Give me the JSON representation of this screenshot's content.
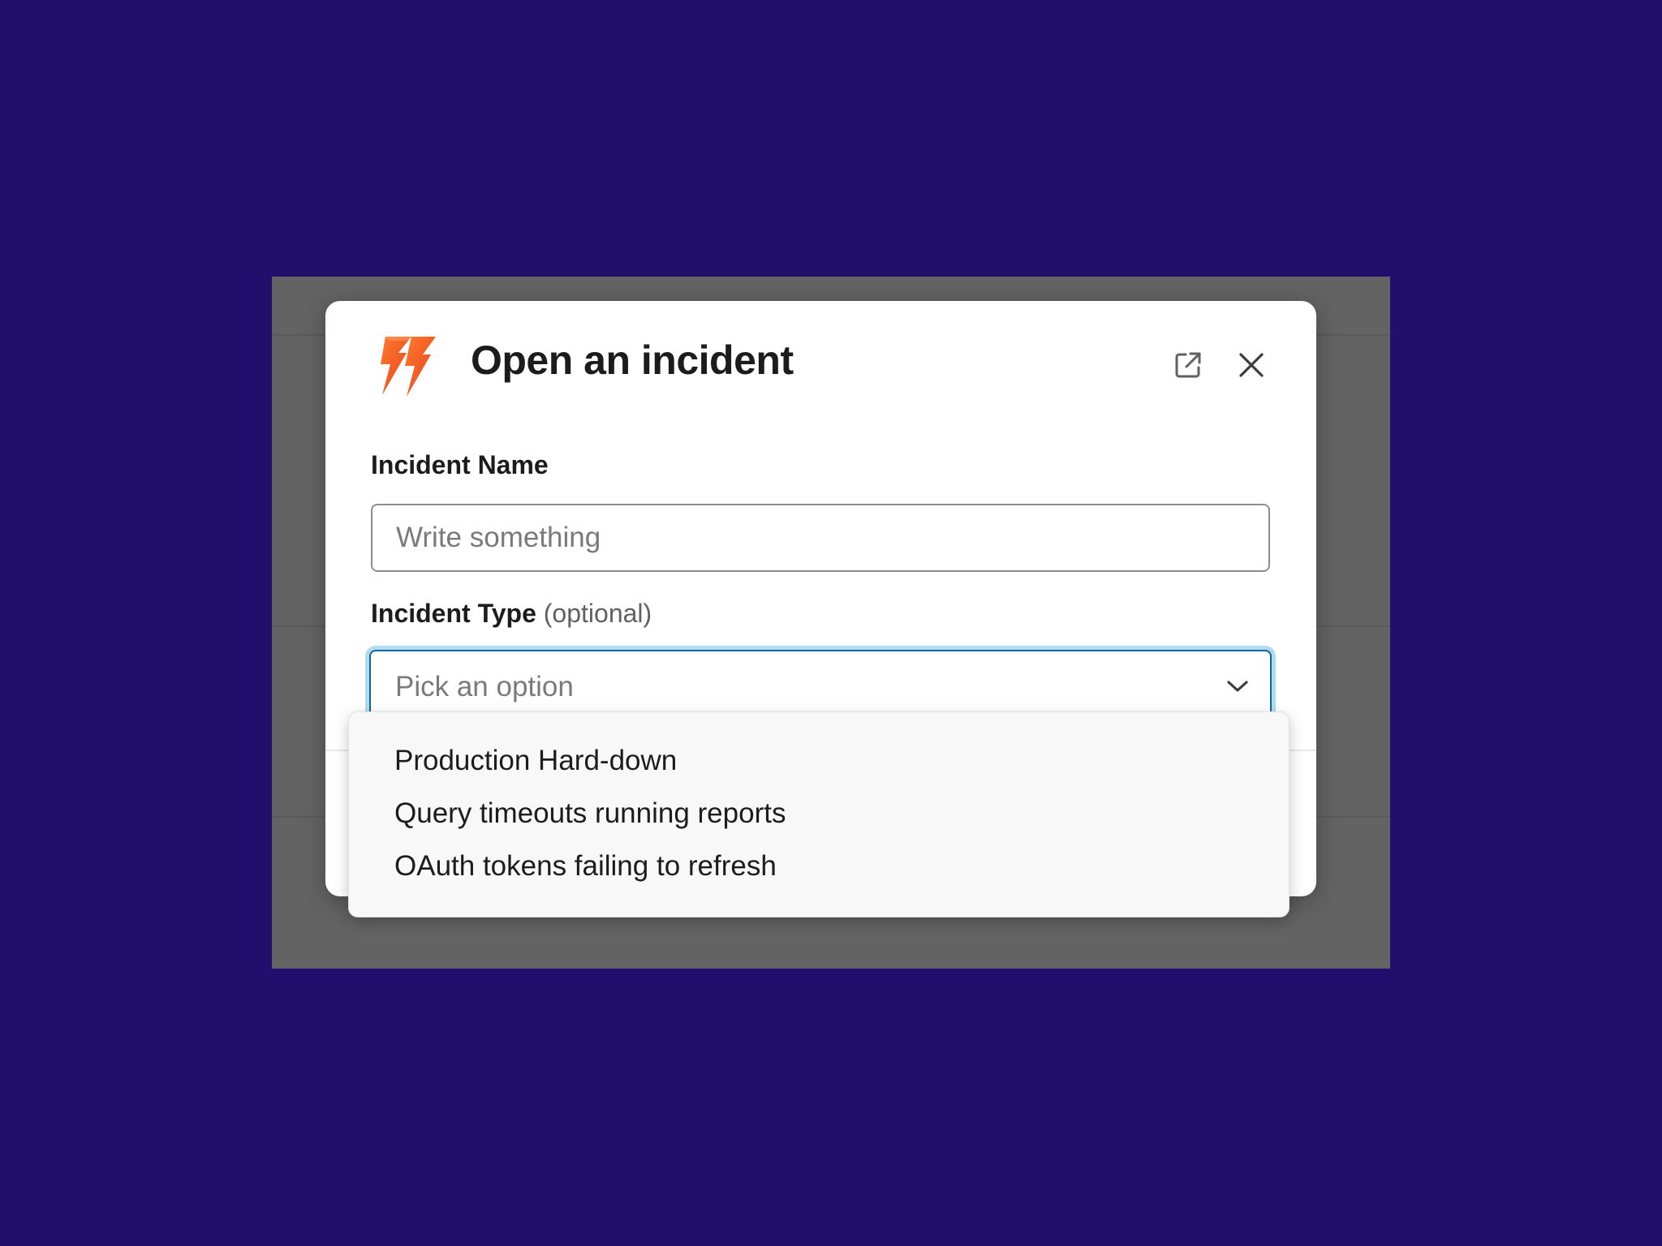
{
  "modal": {
    "title": "Open an incident",
    "logo_icon": "lightning-bolts-logo",
    "accent_color": "#f26322"
  },
  "header_actions": {
    "popout_icon": "external-link-icon",
    "close_icon": "close-icon"
  },
  "fields": {
    "incident_name": {
      "label": "Incident Name",
      "placeholder": "Write something",
      "value": ""
    },
    "incident_type": {
      "label": "Incident Type",
      "optional_hint": "(optional)",
      "placeholder": "Pick an option",
      "focus_color": "#1264a3"
    }
  },
  "dropdown": {
    "options": [
      "Production Hard-down",
      "Query timeouts running reports",
      "OAuth tokens failing to refresh"
    ]
  },
  "colors": {
    "page_background": "#220e6d",
    "overlay": "#636363"
  }
}
